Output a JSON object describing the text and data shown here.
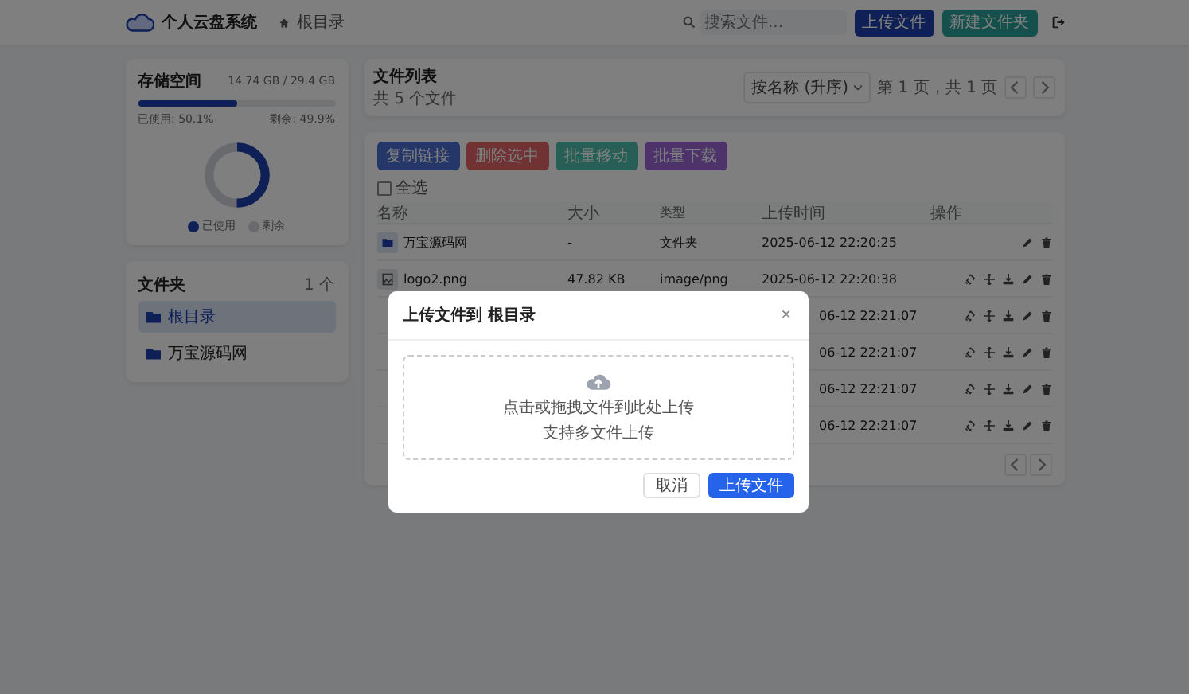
{
  "header": {
    "app_name": "个人云盘系统",
    "breadcrumb": "根目录",
    "search": {
      "placeholder": "搜索文件..."
    },
    "buttons": [
      {
        "label": "上传文件",
        "kind": "upload"
      },
      {
        "label": "新建文件夹",
        "kind": "folder"
      }
    ]
  },
  "storage": {
    "title": "存储空间",
    "usage": "14.74 GB / 29.4 GB",
    "level": 0.501,
    "used_label": "已使用: 50.1%",
    "free_label": "剩余: 49.9%",
    "legend": [
      {
        "label": "已使用",
        "kind": "used"
      },
      {
        "label": "剩余",
        "kind": "free"
      }
    ]
  },
  "folders": {
    "title": "文件夹",
    "count": "1 个",
    "items": [
      {
        "name": "根目录",
        "selected": true
      },
      {
        "name": "万宝源码网",
        "selected": false
      }
    ]
  },
  "file_list": {
    "title": "文件列表",
    "subtitle": "共 5 个文件",
    "sort": "按名称 (升序)",
    "page_info": "第 1 页，共 1 页"
  },
  "bulk_actions": [
    {
      "label": "复制链接",
      "kind": "link"
    },
    {
      "label": "删除选中",
      "kind": "delete"
    },
    {
      "label": "批量移动",
      "kind": "move"
    },
    {
      "label": "批量下载",
      "kind": "download"
    }
  ],
  "select_all": {
    "label": "全选",
    "checked": false
  },
  "table": {
    "columns": [
      "名称",
      "大小",
      "类型",
      "上传时间",
      "操作"
    ],
    "rows": [
      {
        "kind": "folder",
        "name": "万宝源码网",
        "size": "-",
        "type": "文件夹",
        "time": "2025-06-12 22:20:25"
      },
      {
        "kind": "file",
        "name": "logo2.png",
        "size": "47.82 KB",
        "type": "image/png",
        "time": "2025-06-12 22:20:38"
      },
      {
        "kind": "covered",
        "time": "06-12 22:21:07"
      },
      {
        "kind": "covered",
        "time": "06-12 22:21:07"
      },
      {
        "kind": "covered",
        "time": "06-12 22:21:07"
      },
      {
        "kind": "covered",
        "time": "06-12 22:21:07"
      }
    ]
  },
  "modal": {
    "title": "上传文件到 根目录",
    "close": "×",
    "drop_text": "点击或拖拽文件到此处上传",
    "drop_hint": "支持多文件上传",
    "buttons": [
      {
        "label": "取消",
        "kind": "secondary"
      },
      {
        "label": "上传文件",
        "kind": "primary"
      }
    ]
  }
}
